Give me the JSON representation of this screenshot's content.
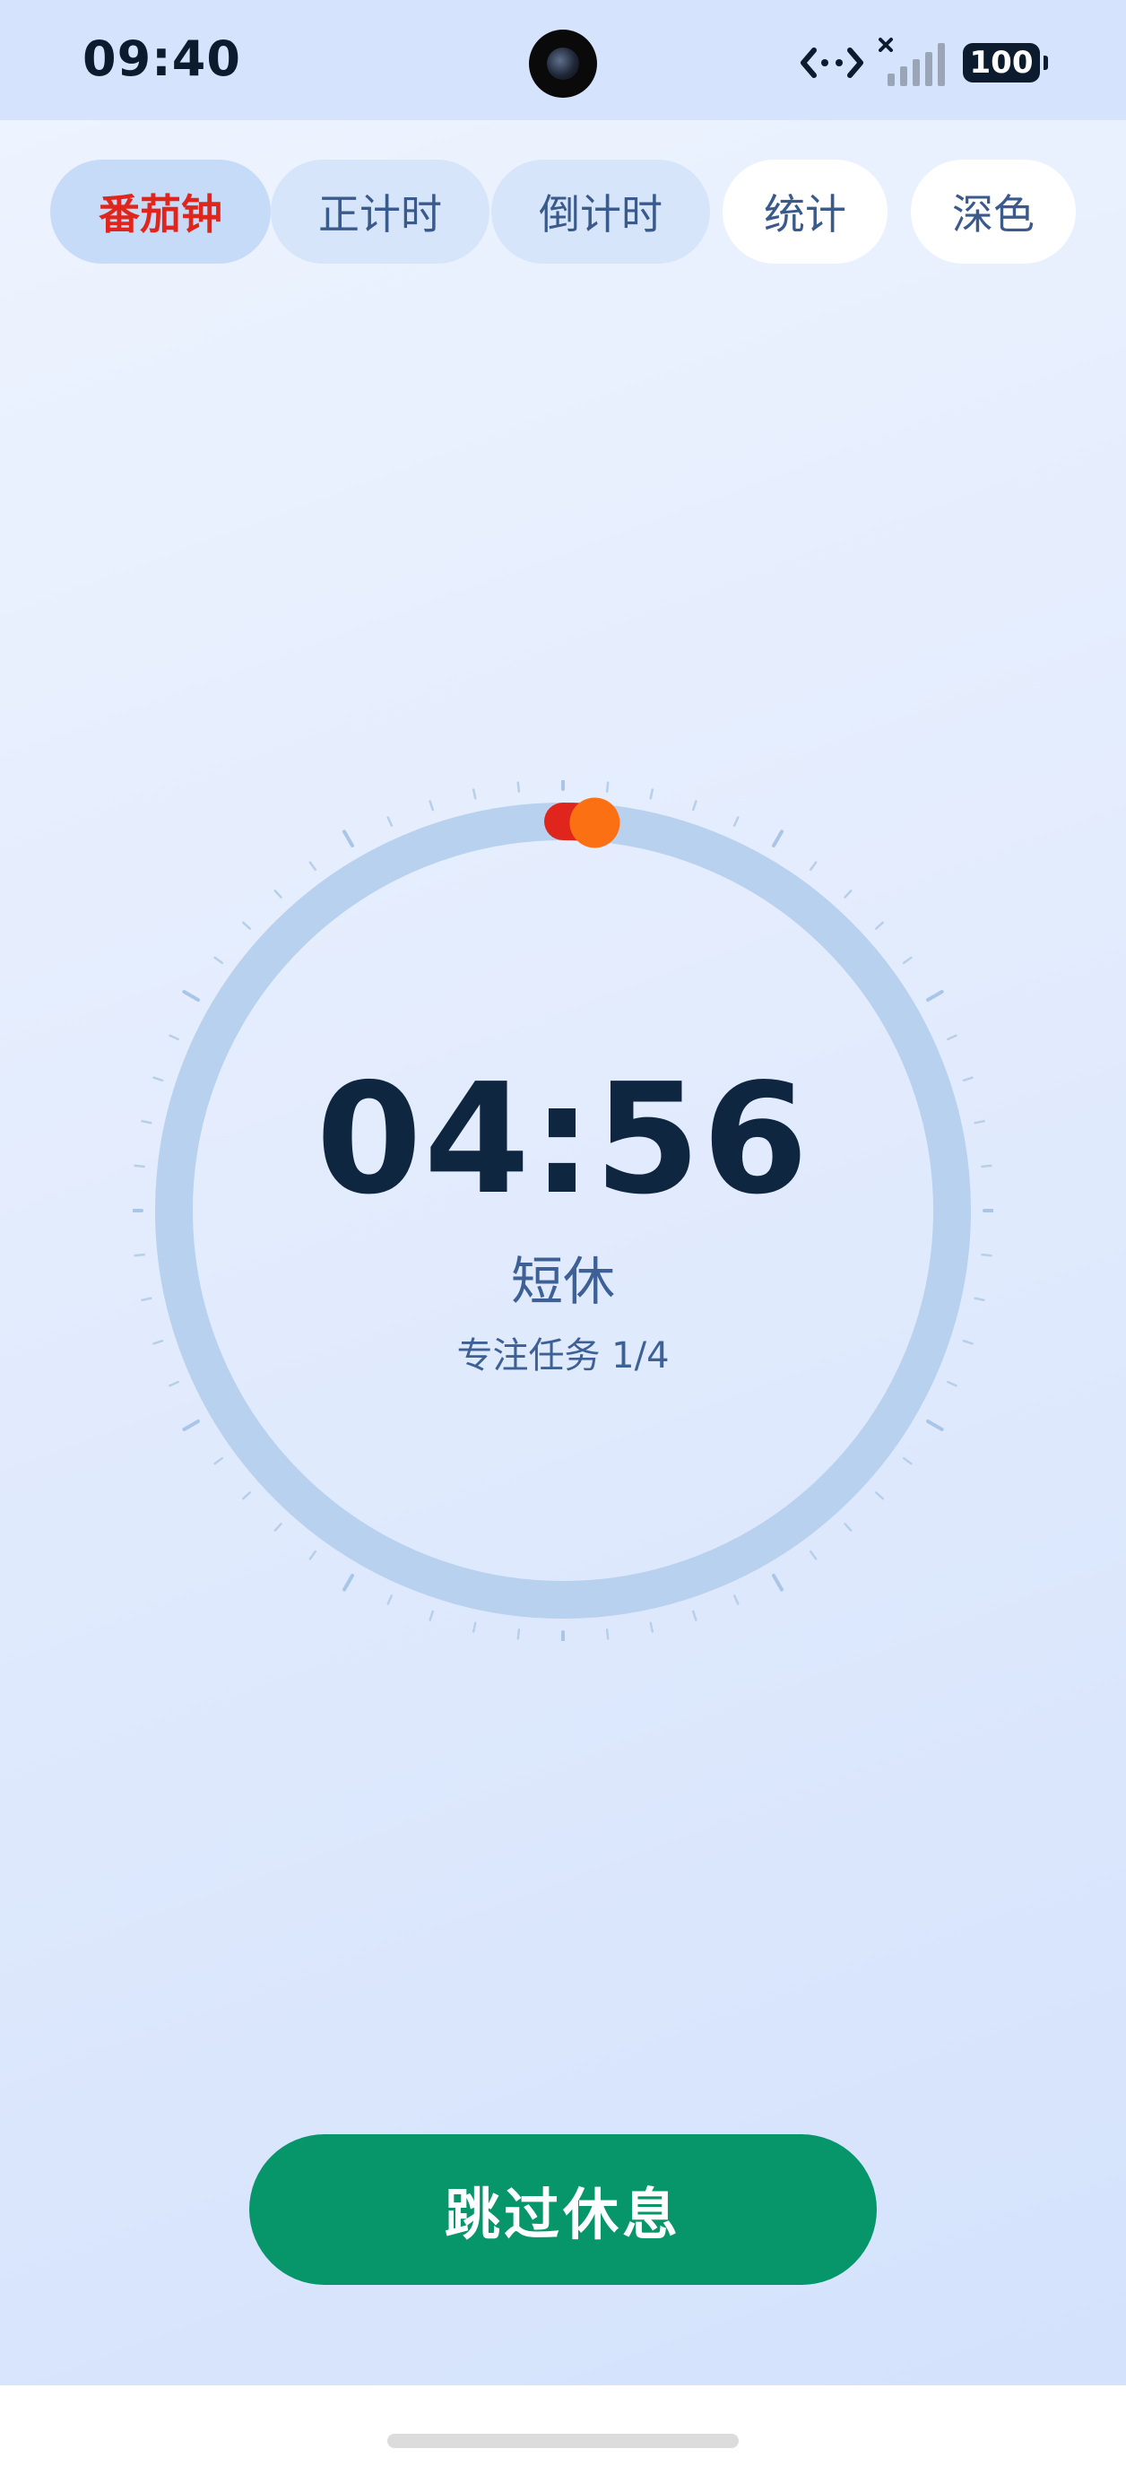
{
  "status_bar": {
    "time": "09:40",
    "battery": "100",
    "icons": [
      "camera-hole",
      "data-transfer-icon",
      "signal-no-service-icon",
      "battery-icon"
    ]
  },
  "tabs": [
    {
      "label": "番茄钟",
      "active": true
    },
    {
      "label": "正计时",
      "active": false
    },
    {
      "label": "倒计时",
      "active": false
    },
    {
      "label": "统计",
      "active": false
    },
    {
      "label": "深色",
      "active": false
    }
  ],
  "timer": {
    "time": "04:56",
    "mode": "短休",
    "task": "专注任务 1/4",
    "progress_fraction": 0.013
  },
  "actions": {
    "skip_label": "跳过休息"
  },
  "colors": {
    "active_tab_text": "#e0261c",
    "tab_text": "#3a5a8c",
    "ring": "#b7d1ee",
    "progress_start": "#e0261c",
    "progress_end": "#fb7012",
    "button": "#079669"
  }
}
